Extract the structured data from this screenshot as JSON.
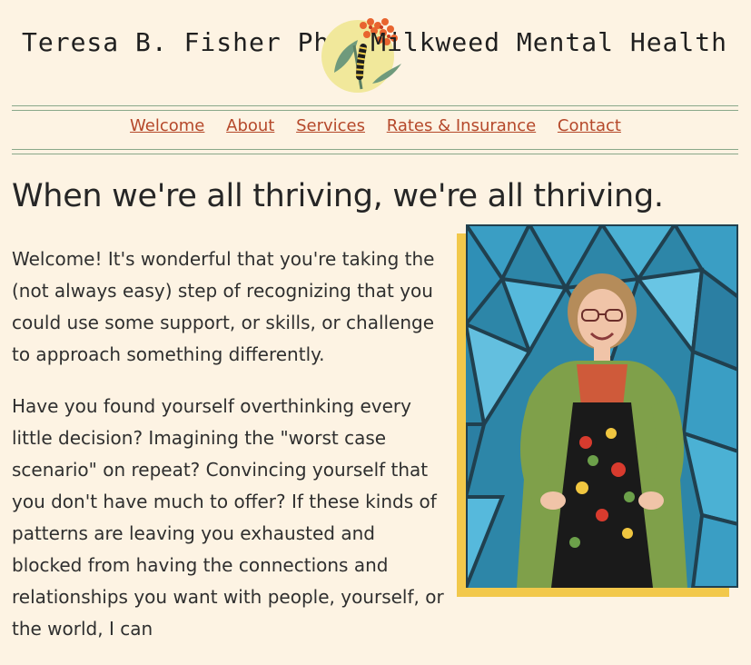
{
  "header": {
    "name": "Teresa B. Fisher PhD.",
    "practice": "Milkweed Mental Health",
    "logo_icon": "milkweed-caterpillar-logo"
  },
  "nav": {
    "items": [
      {
        "label": "Welcome"
      },
      {
        "label": "About"
      },
      {
        "label": "Services"
      },
      {
        "label": "Rates & Insurance"
      },
      {
        "label": "Contact"
      }
    ]
  },
  "main": {
    "headline": "When we're all thriving, we're all thriving.",
    "paragraphs": [
      "Welcome! It's wonderful that you're taking the (not always easy) step of recognizing that you could use some support, or skills, or challenge to approach something differently.",
      "Have you found yourself overthinking every little decision? Imagining the \"worst case scenario\" on repeat? Convincing yourself that you don't have much to offer? If these kinds of patterns are leaving you exhausted and blocked from having the connections and relationships you want with people, yourself, or the world, I can"
    ],
    "photo_icon": "portrait-photo"
  },
  "colors": {
    "background": "#fdf3e3",
    "link": "#b5482a",
    "rule": "#8aa88a",
    "accent": "#f2c84b"
  }
}
